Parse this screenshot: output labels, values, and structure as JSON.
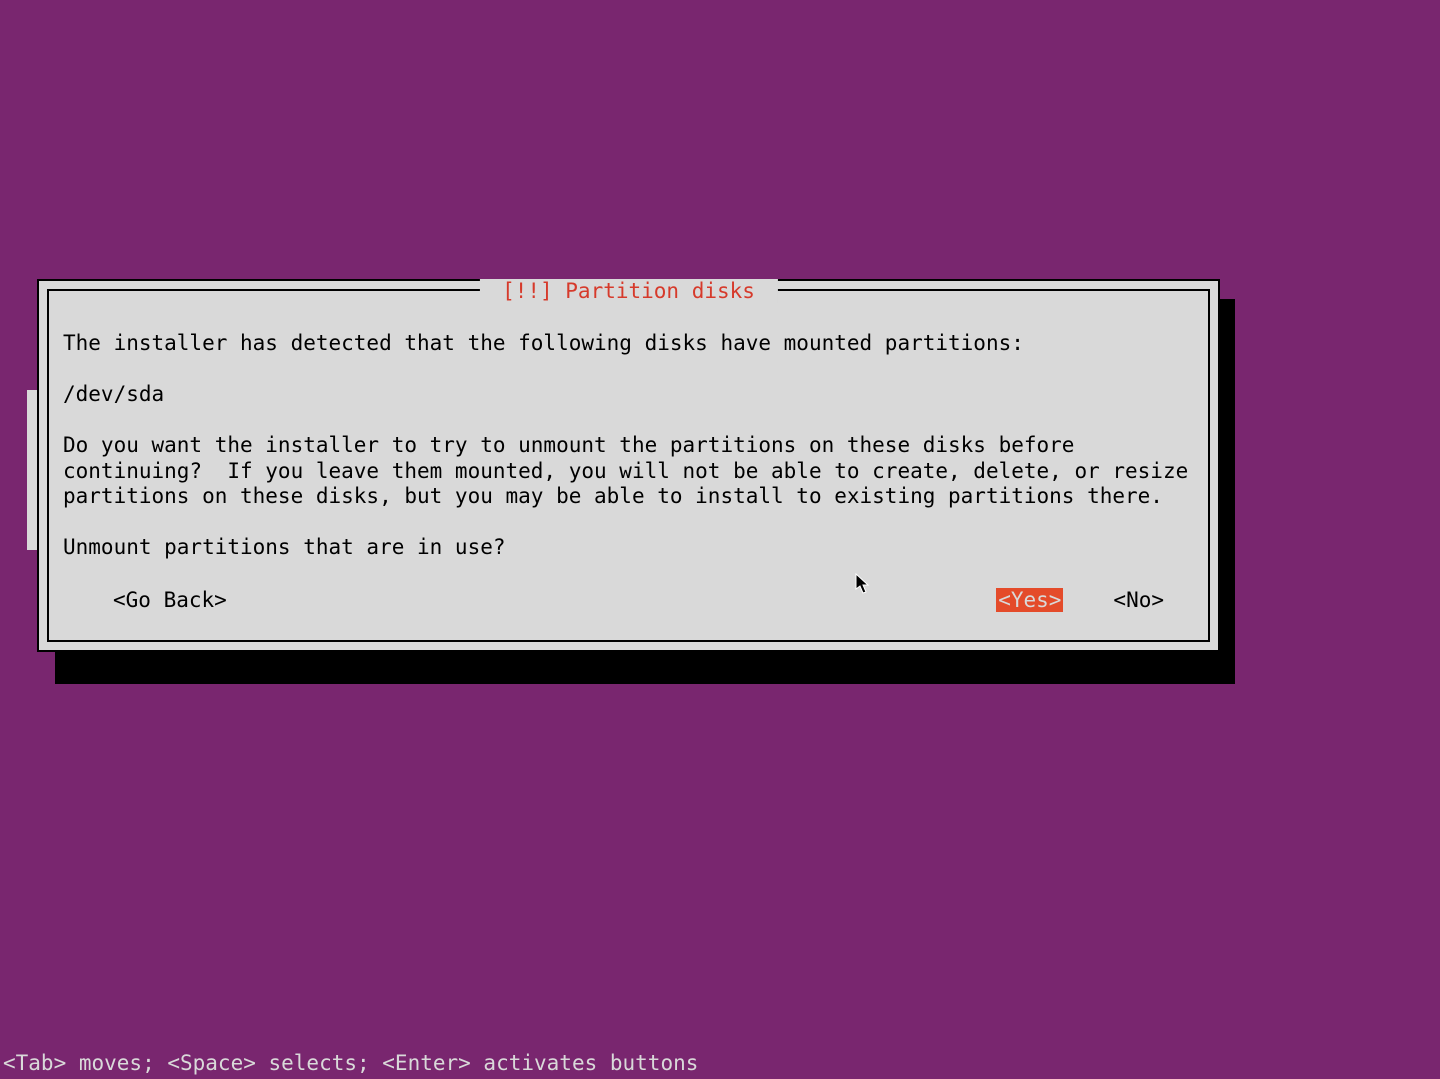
{
  "dialog": {
    "title": " [!!] Partition disks ",
    "intro": "The installer has detected that the following disks have mounted partitions:",
    "device": "/dev/sda",
    "question": "Do you want the installer to try to unmount the partitions on these disks before continuing?  If you leave them mounted, you will not be able to create, delete, or resize partitions on these disks, but you may be able to install to existing partitions there.",
    "prompt": "Unmount partitions that are in use?",
    "buttons": {
      "goback": "<Go Back>",
      "yes": "<Yes>",
      "no": "<No>"
    },
    "selected": "yes"
  },
  "statusbar": "<Tab> moves; <Space> selects; <Enter> activates buttons"
}
